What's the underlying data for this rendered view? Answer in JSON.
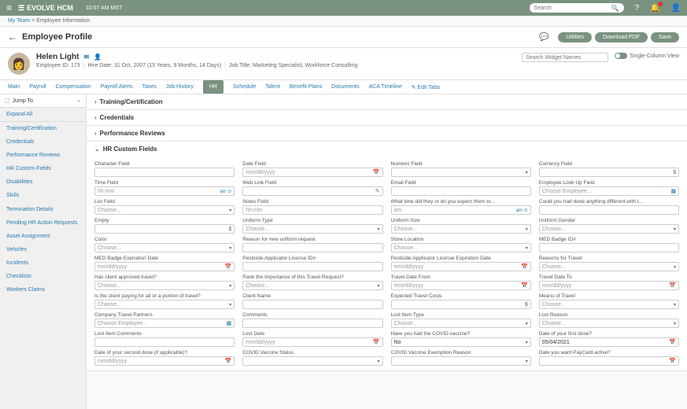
{
  "topbar": {
    "brand": "EVOLVE HCM",
    "time": "10:57 AM MST",
    "search_ph": "Search"
  },
  "crumb": {
    "a": "My Team",
    "b": "Employee Information"
  },
  "header": {
    "title": "Employee Profile",
    "chat_icon": "chat",
    "utilities": "Utilities",
    "download": "Download PDF",
    "save": "Save"
  },
  "emp": {
    "name": "Helen Light",
    "id_label": "Employee ID:",
    "id": "173",
    "hire": "Hire Date: 31 Oct, 2007 (15 Years, 9 Months, 14 Days)",
    "title": "Job Title: Marketing Specialist, Workforce Consulting",
    "search_ph": "Search Widget Names",
    "toggle": "Single-Column View"
  },
  "tabs": [
    "Main",
    "Payroll",
    "Compensation",
    "Payroll Alerts",
    "Taxes",
    "Job History",
    "HR",
    "Schedule",
    "Talent",
    "Benefit Plans",
    "Documents",
    "ACA Timeline"
  ],
  "edit_tabs": "Edit Tabs",
  "side": {
    "jump": "Jump To",
    "expand": "Expand All",
    "links": [
      "Training/Certification",
      "Credentials",
      "Performance Reviews",
      "HR Custom Fields",
      "Disabilities",
      "Skills",
      "Termination Details",
      "Pending HR Action Requests",
      "Asset Assignment",
      "Vehicles",
      "Incidents",
      "Checklists",
      "Workers Claims"
    ]
  },
  "sections": {
    "train": "Training/Certification",
    "cred": "Credentials",
    "perf": "Performance Reviews",
    "hrcf": "HR Custom Fields"
  },
  "fields": [
    [
      {
        "l": "Character Field",
        "t": "text"
      },
      {
        "l": "Date Field",
        "p": "mm/dd/yyyy",
        "t": "date"
      },
      {
        "l": "Numeric Field",
        "t": "num"
      },
      {
        "l": "Currency Field",
        "t": "cur"
      }
    ],
    [
      {
        "l": "Time Field",
        "p": "hh:mm",
        "t": "time"
      },
      {
        "l": "Web Link Field",
        "t": "link"
      },
      {
        "l": "Email Field",
        "t": "text"
      },
      {
        "l": "Employee Look Up Field",
        "p": "Choose Employee...",
        "t": "lookup"
      }
    ],
    [
      {
        "l": "List Field",
        "p": "Choose...",
        "t": "sel"
      },
      {
        "l": "Notes Field",
        "p": "hh:mm",
        "t": "text"
      },
      {
        "l": "What time did they or do you expect them to...",
        "t": "time",
        "p": "am"
      },
      {
        "l": "Could you had done anything different with t...",
        "t": "text"
      }
    ],
    [
      {
        "l": "Empty",
        "t": "cur"
      },
      {
        "l": "Uniform Type",
        "p": "Choose...",
        "t": "sel"
      },
      {
        "l": "Uniform Size",
        "p": "Choose...",
        "t": "sel"
      },
      {
        "l": "Uniform Gender",
        "p": "Choose...",
        "t": "sel"
      }
    ],
    [
      {
        "l": "Color",
        "p": "Choose...",
        "t": "sel"
      },
      {
        "l": "Reason for new uniform request",
        "t": "text"
      },
      {
        "l": "Store Location",
        "p": "Choose...",
        "t": "sel"
      },
      {
        "l": "MED Badge ID#",
        "t": "text"
      }
    ],
    [
      {
        "l": "MED Badge Expiration Date",
        "p": "mm/dd/yyyy",
        "t": "date"
      },
      {
        "l": "Pesticide Applicator License ID#",
        "t": "text"
      },
      {
        "l": "Pesticide Applicator License Expiration Date",
        "p": "mm/dd/yyyy",
        "t": "date"
      },
      {
        "l": "Reasons for Travel",
        "p": "Choose...",
        "t": "sel"
      }
    ],
    [
      {
        "l": "Has client approved travel?",
        "p": "Choose...",
        "t": "sel"
      },
      {
        "l": "Rank the Importance of this Travel Request?",
        "p": "Choose...",
        "t": "sel"
      },
      {
        "l": "Travel Date From",
        "p": "mm/dd/yyyy",
        "t": "date"
      },
      {
        "l": "Travel Date To",
        "p": "mm/dd/yyyy",
        "t": "date"
      }
    ],
    [
      {
        "l": "Is the client paying for all or a portion of travel?",
        "p": "Choose...",
        "t": "sel"
      },
      {
        "l": "Client Name",
        "t": "text"
      },
      {
        "l": "Expected Travel Costs",
        "t": "cur"
      },
      {
        "l": "Means of Travel",
        "p": "Choose...",
        "t": "sel"
      }
    ],
    [
      {
        "l": "Company Travel Partners",
        "p": "Choose Employee...",
        "t": "lookup"
      },
      {
        "l": "Comments",
        "t": "text"
      },
      {
        "l": "Lost Item Type",
        "p": "Choose...",
        "t": "sel"
      },
      {
        "l": "Lost Reason",
        "p": "Choose...",
        "t": "sel"
      }
    ],
    [
      {
        "l": "Lost Item Comments",
        "t": "text"
      },
      {
        "l": "Lost Date",
        "p": "mm/dd/yyyy",
        "t": "date"
      },
      {
        "l": "Have you had the COVID vaccine?",
        "v": "No",
        "t": "sel"
      },
      {
        "l": "Date of your first dose?",
        "v": "05/04/2021",
        "t": "date"
      }
    ],
    [
      {
        "l": "Date of your second dose (if applicable)?",
        "p": "mm/dd/yyyy",
        "t": "date"
      },
      {
        "l": "COVID Vaccine Status",
        "t": "sel"
      },
      {
        "l": "COVID Vaccine Exemption Reason",
        "t": "sel"
      },
      {
        "l": "Date you want PayCard active?",
        "t": "date"
      }
    ]
  ]
}
